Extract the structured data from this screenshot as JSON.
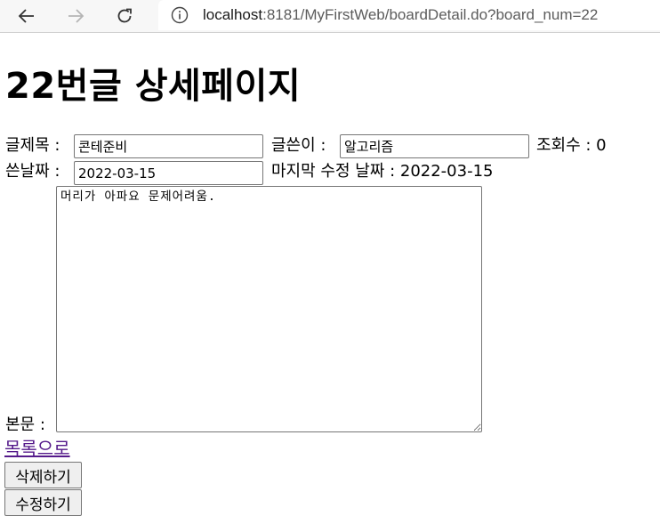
{
  "browser": {
    "url_host": "localhost",
    "url_rest": ":8181/MyFirstWeb/boardDetail.do?board_num=22"
  },
  "page": {
    "title": "22번글 상세페이지"
  },
  "form": {
    "subject_label": "글제목 :",
    "subject_value": "콘테준비",
    "writer_label": "글쓴이 :",
    "writer_value": "알고리즘",
    "views_label": "조회수 : 0",
    "date_label": "쓴날짜 :",
    "date_value": "2022-03-15",
    "modified_label": "마지막 수정 날짜 : 2022-03-15",
    "content_label": "본문 :",
    "content_value": "머리가 아파요 문제어려움."
  },
  "actions": {
    "list_link": "목록으로",
    "delete_button": "삭제하기",
    "edit_button": "수정하기"
  }
}
